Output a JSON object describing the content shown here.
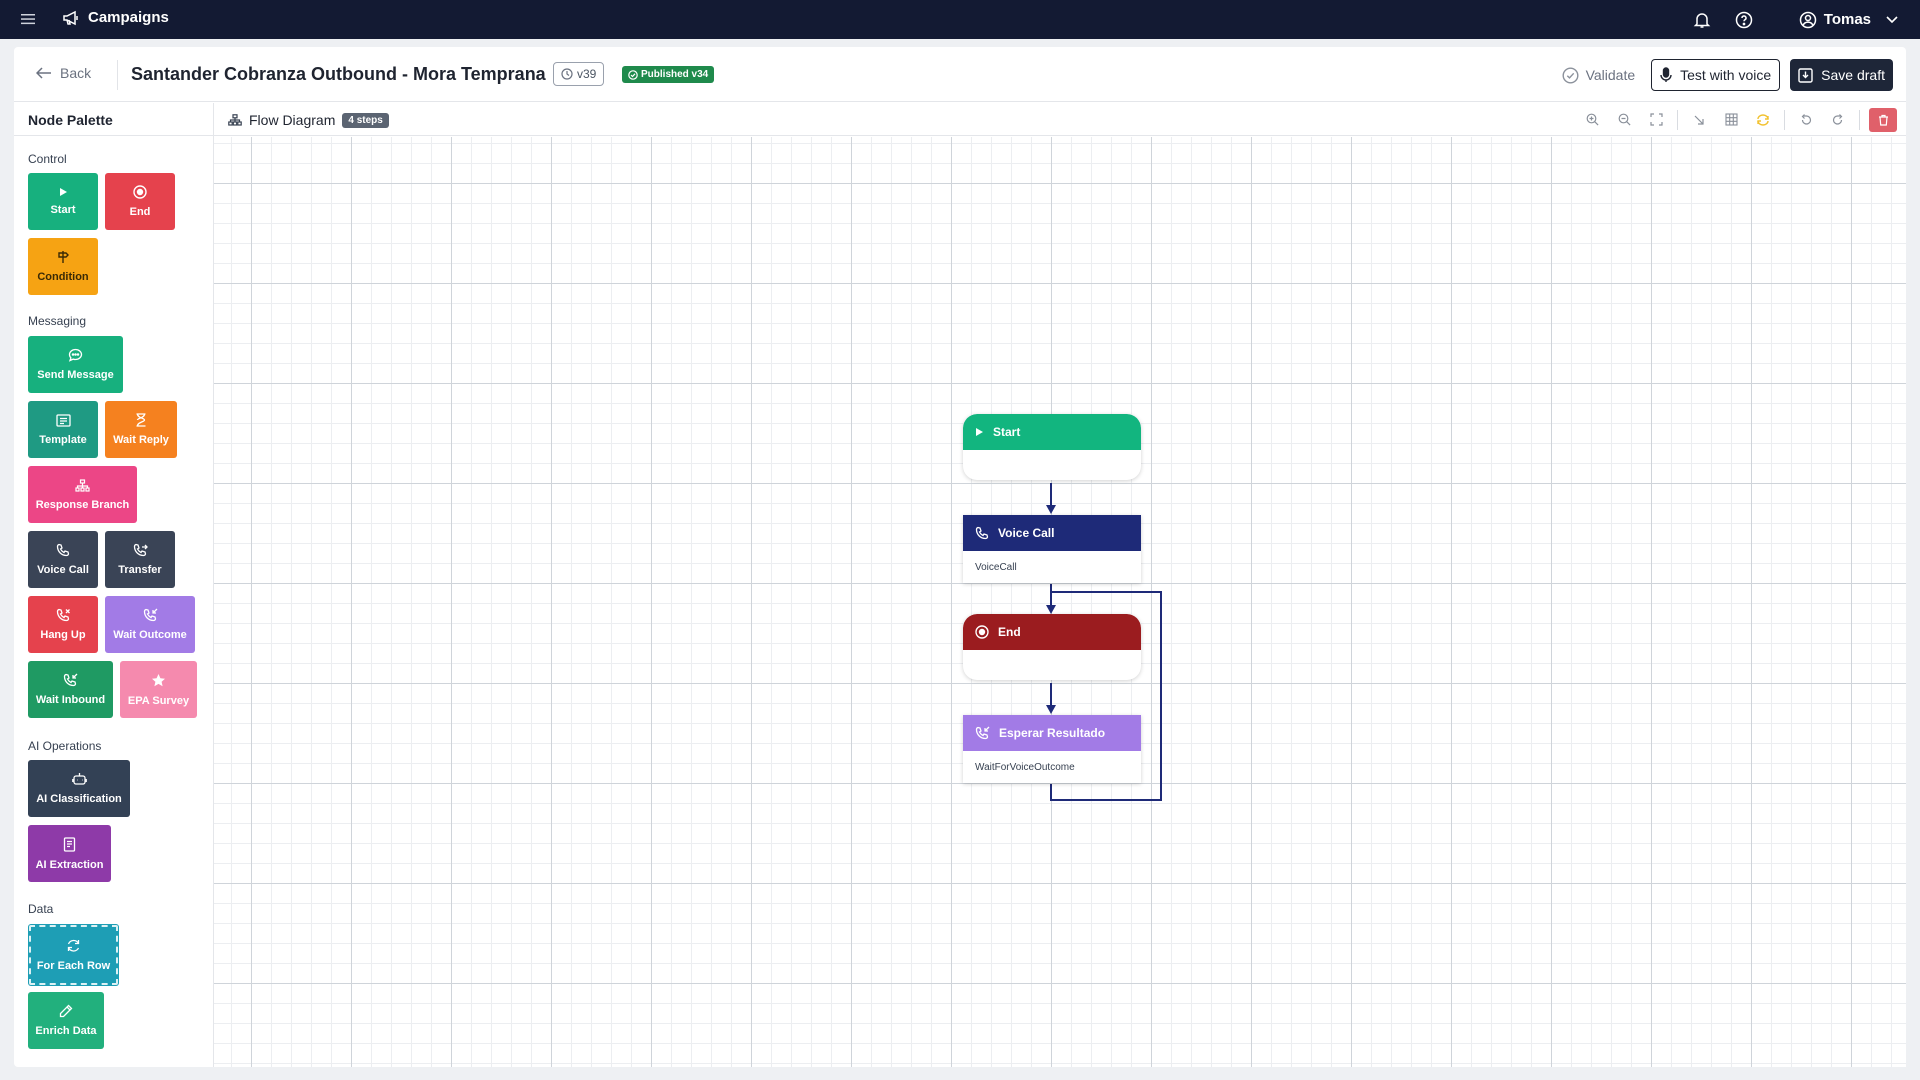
{
  "topbar": {
    "app_title": "Campaigns",
    "user_name": "Tomas"
  },
  "header": {
    "back_label": "Back",
    "title": "Santander Cobranza Outbound - Mora Temprana",
    "version": "v39",
    "published": "Published v34",
    "validate_label": "Validate",
    "test_voice_label": "Test with voice",
    "save_draft_label": "Save draft"
  },
  "palette": {
    "title": "Node Palette",
    "sections": {
      "control": "Control",
      "messaging": "Messaging",
      "ai": "AI Operations",
      "data": "Data"
    },
    "items": {
      "start": {
        "label": "Start",
        "color": "#17b07e"
      },
      "end": {
        "label": "End",
        "color": "#e5424d"
      },
      "condition": {
        "label": "Condition",
        "color": "#f6a313"
      },
      "send_message": {
        "label": "Send Message",
        "color": "#17b07e"
      },
      "template": {
        "label": "Template",
        "color": "#1f9a83"
      },
      "wait_reply": {
        "label": "Wait Reply",
        "color": "#f5811f"
      },
      "response_branch": {
        "label": "Response Branch",
        "color": "#ec4686"
      },
      "voice_call": {
        "label": "Voice Call",
        "color": "#3a4456"
      },
      "transfer": {
        "label": "Transfer",
        "color": "#3a4456"
      },
      "hang_up": {
        "label": "Hang Up",
        "color": "#e5424d"
      },
      "wait_outcome": {
        "label": "Wait Outcome",
        "color": "#a27be6"
      },
      "wait_inbound": {
        "label": "Wait Inbound",
        "color": "#1f9a63"
      },
      "epa_survey": {
        "label": "EPA Survey",
        "color": "#f58aae"
      },
      "ai_classification": {
        "label": "AI Classification",
        "color": "#334155"
      },
      "ai_extraction": {
        "label": "AI Extraction",
        "color": "#8e3aa8"
      },
      "for_each_row": {
        "label": "For Each Row",
        "color": "#1e9eb5"
      },
      "enrich_data": {
        "label": "Enrich Data",
        "color": "#22b07d"
      }
    }
  },
  "canvas": {
    "title": "Flow Diagram",
    "steps_badge": "4 steps",
    "accent_color": "#1e2a78"
  },
  "flow": {
    "start": {
      "label": "Start",
      "color": "#12b57f"
    },
    "voice_call": {
      "label": "Voice Call",
      "sublabel": "VoiceCall",
      "color": "#1e2a78"
    },
    "end": {
      "label": "End",
      "color": "#9b1c1f"
    },
    "wait": {
      "label": "Esperar Resultado",
      "sublabel": "WaitForVoiceOutcome",
      "color": "#a27be6"
    }
  }
}
